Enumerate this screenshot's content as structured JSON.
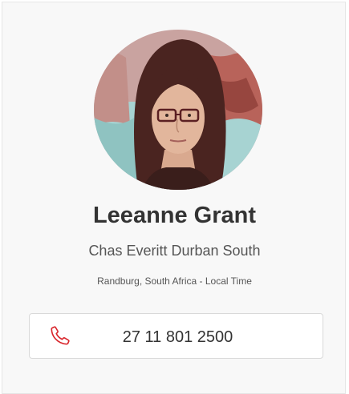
{
  "agent": {
    "name": "Leeanne Grant",
    "office": "Chas Everitt Durban South",
    "location": "Randburg, South Africa - Local Time"
  },
  "contact": {
    "phone": "27 11 801 2500",
    "phone_icon": "phone-icon"
  },
  "colors": {
    "accent": "#d9262c",
    "name_text": "#333333",
    "card_bg": "#f8f8f8"
  }
}
